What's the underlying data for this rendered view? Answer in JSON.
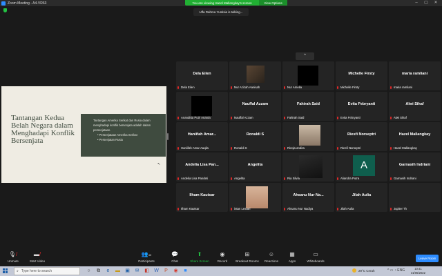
{
  "window": {
    "title": "Zoom Meeting - A4-VR63",
    "viewing_banner": "You are viewing Hazel Mallangkay's screen",
    "view_options": "View Options"
  },
  "talking_indicator": "Ulfa Rahma Yustisia is talking...",
  "slide": {
    "title": "Tantangan Kedua Belah Negara dalam Menghadapi Konflik Bersenjata",
    "body": "Tantangan Amerika Serikat dan Rusia dalam menghadapi konflik bersenjata adalah dalam persenjataan.",
    "bullets": [
      "Persenjataan Amerika Serikat",
      "Persenjatan Rusia"
    ]
  },
  "gallery_scroll_up": "^",
  "participants": [
    {
      "big": "Dela Eilen",
      "caption": "Dela Eilen",
      "video": "none"
    },
    {
      "big": "",
      "caption": "Nur Azizah Aanisah",
      "video": "room"
    },
    {
      "big": "",
      "caption": "Nur Amelia",
      "video": "black"
    },
    {
      "big": "Michelle Firsty",
      "caption": "Michelle Firsty",
      "video": "none"
    },
    {
      "big": "maria ramliani",
      "caption": "maria ramliani",
      "video": "none"
    },
    {
      "big": "",
      "caption": "Ananditta Putri Ananta",
      "video": "black"
    },
    {
      "big": "Nauffal Azzam",
      "caption": "Nauffal Azzam",
      "video": "none"
    },
    {
      "big": "Fahirah Said",
      "caption": "Fahirah Said",
      "video": "none"
    },
    {
      "big": "Evita Febryanti",
      "caption": "Evita Febryanti",
      "video": "none"
    },
    {
      "big": "Alwi Sihaf",
      "caption": "Alwi Sihaf",
      "video": "none"
    },
    {
      "big": "Haniifah Amar...",
      "caption": "Haniifah Amar Aaqila",
      "video": "none"
    },
    {
      "big": "Ronaldi S",
      "caption": "Ronaldi S",
      "video": "none"
    },
    {
      "big": "",
      "caption": "Rizqia andita",
      "video": "street"
    },
    {
      "big": "Riesfi Norseptri",
      "caption": "Riesfi Norseptri",
      "video": "none"
    },
    {
      "big": "Hazel Mallangkay",
      "caption": "Hazel Mallangkay",
      "video": "none"
    },
    {
      "big": "Andelia Lisa Pan...",
      "caption": "Andelia Lisa Pandeti",
      "video": "none"
    },
    {
      "big": "Angelita",
      "caption": "Angelita",
      "video": "none"
    },
    {
      "big": "",
      "caption": "Ria Silvia",
      "video": "dark"
    },
    {
      "big": "",
      "caption": "Aliandra Putra",
      "video": "avatar",
      "avatar_letter": "A"
    },
    {
      "big": "Garnasih Indriani",
      "caption": "Garnasih Indriani",
      "video": "none"
    },
    {
      "big": "Ilham Kautsar",
      "caption": "Ilham Kautsar",
      "video": "none"
    },
    {
      "big": "",
      "caption": "intan Lestari",
      "video": "face"
    },
    {
      "big": "Ahsanu Nur Na...",
      "caption": "Ahsanu Nur Nadiya",
      "video": "none"
    },
    {
      "big": "Jilah Aulia",
      "caption": "Jilah Aulia",
      "video": "none"
    },
    {
      "big": "",
      "caption": "Jupiter Th",
      "video": "none"
    }
  ],
  "toolbar": {
    "unmute": "Unmute",
    "start_video": "Start Video",
    "participants": "Participants",
    "participants_count": "40",
    "chat": "Chat",
    "share_screen": "Share Screen",
    "record": "Record",
    "breakout": "Breakout Rooms",
    "reactions": "Reactions",
    "apps": "Apps",
    "whiteboards": "Whiteboards",
    "leave": "Leave Room"
  },
  "taskbar": {
    "search_placeholder": "Type here to search",
    "weather": "29°C  Cerah",
    "time": "10:41",
    "date": "31/05/2022",
    "lang": "ENG"
  },
  "colors": {
    "accent": "#2d8cff",
    "share_green": "#23c343",
    "muted_red": "#e02828",
    "slide_panel": "#3f4b3f"
  }
}
